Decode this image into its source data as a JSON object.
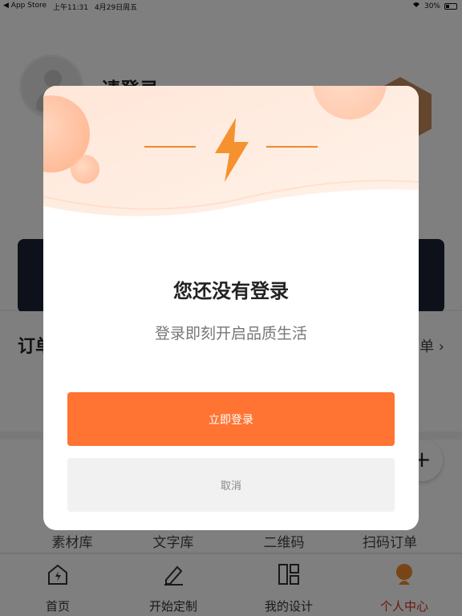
{
  "status_bar": {
    "back_app": "◀ App Store",
    "time": "上午11:31",
    "date": "4月29日周五",
    "battery": "30%"
  },
  "profile": {
    "login_prompt": "请登录~"
  },
  "orders": {
    "title": "订单",
    "more": "单 ›"
  },
  "tools": {
    "items": [
      "素材库",
      "文字库",
      "二维码",
      "扫码订单"
    ]
  },
  "tabbar": {
    "items": [
      {
        "label": "首页",
        "icon": "home-icon"
      },
      {
        "label": "开始定制",
        "icon": "edit-icon"
      },
      {
        "label": "我的设计",
        "icon": "layout-icon"
      },
      {
        "label": "个人中心",
        "icon": "user-icon"
      }
    ],
    "active_index": 3
  },
  "modal": {
    "title": "您还没有登录",
    "subtitle": "登录即刻开启品质生活",
    "login_button": "立即登录",
    "cancel_button": "取消",
    "hero_icon": "lightning-icon"
  },
  "colors": {
    "accent": "#ff7433",
    "active_tab": "#d9321f"
  }
}
